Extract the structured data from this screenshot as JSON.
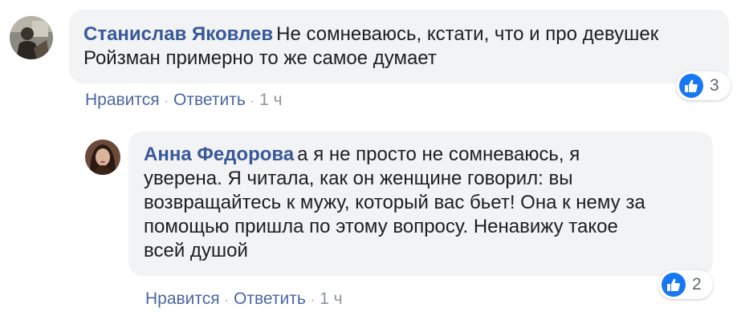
{
  "comments": [
    {
      "author": "Станислав Яковлев",
      "text_lines": [
        "Не сомневаюсь, кстати, что и про девушек",
        "Ройзман примерно то же самое думает"
      ],
      "reactions_count": "3",
      "actions": {
        "like": "Нравится",
        "reply": "Ответить",
        "time": "1 ч"
      },
      "icons": {
        "avatar": "user-avatar-photo",
        "reaction": "like-thumb-icon"
      }
    },
    {
      "author": "Анна Федорова",
      "text_lines": [
        "а я не просто не сомневаюсь, я",
        "уверена. Я читала, как он женщине говорил: вы",
        "возвращайтесь к мужу, который вас бьет! Она к нему за",
        "помощью пришла по этому вопросу. Ненавижу такое",
        "всей душой"
      ],
      "reactions_count": "2",
      "actions": {
        "like": "Нравится",
        "reply": "Ответить",
        "time": "1 ч"
      },
      "icons": {
        "avatar": "user-avatar-photo",
        "reaction": "like-thumb-icon"
      }
    }
  ],
  "colors": {
    "bubble": "#f2f3f5",
    "author": "#385898",
    "link": "#4b67a1",
    "like_blue": "#1877f2",
    "muted": "#90949c"
  }
}
